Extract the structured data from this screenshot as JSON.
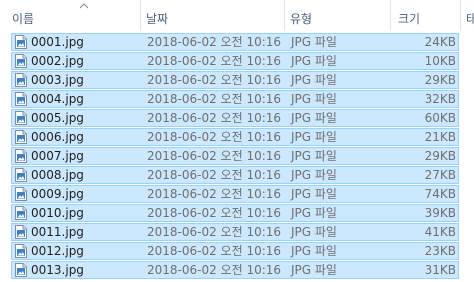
{
  "columns": {
    "name": "이름",
    "date": "날짜",
    "type": "유형",
    "size": "크기",
    "extra": "태"
  },
  "files": [
    {
      "name": "0001.jpg",
      "date": "2018-06-02 오전 10:16",
      "type": "JPG 파일",
      "size": "24KB"
    },
    {
      "name": "0002.jpg",
      "date": "2018-06-02 오전 10:16",
      "type": "JPG 파일",
      "size": "10KB"
    },
    {
      "name": "0003.jpg",
      "date": "2018-06-02 오전 10:16",
      "type": "JPG 파일",
      "size": "29KB"
    },
    {
      "name": "0004.jpg",
      "date": "2018-06-02 오전 10:16",
      "type": "JPG 파일",
      "size": "32KB"
    },
    {
      "name": "0005.jpg",
      "date": "2018-06-02 오전 10:16",
      "type": "JPG 파일",
      "size": "60KB"
    },
    {
      "name": "0006.jpg",
      "date": "2018-06-02 오전 10:16",
      "type": "JPG 파일",
      "size": "21KB"
    },
    {
      "name": "0007.jpg",
      "date": "2018-06-02 오전 10:16",
      "type": "JPG 파일",
      "size": "29KB"
    },
    {
      "name": "0008.jpg",
      "date": "2018-06-02 오전 10:16",
      "type": "JPG 파일",
      "size": "27KB"
    },
    {
      "name": "0009.jpg",
      "date": "2018-06-02 오전 10:16",
      "type": "JPG 파일",
      "size": "74KB"
    },
    {
      "name": "0010.jpg",
      "date": "2018-06-02 오전 10:16",
      "type": "JPG 파일",
      "size": "39KB"
    },
    {
      "name": "0011.jpg",
      "date": "2018-06-02 오전 10:16",
      "type": "JPG 파일",
      "size": "41KB"
    },
    {
      "name": "0012.jpg",
      "date": "2018-06-02 오전 10:16",
      "type": "JPG 파일",
      "size": "23KB"
    },
    {
      "name": "0013.jpg",
      "date": "2018-06-02 오전 10:16",
      "type": "JPG 파일",
      "size": "31KB"
    }
  ],
  "selection_color": "#cce8ff",
  "selection_border": "#99d1ff",
  "icons": {
    "sort": "chevron-up-icon",
    "file": "image-file-icon"
  }
}
